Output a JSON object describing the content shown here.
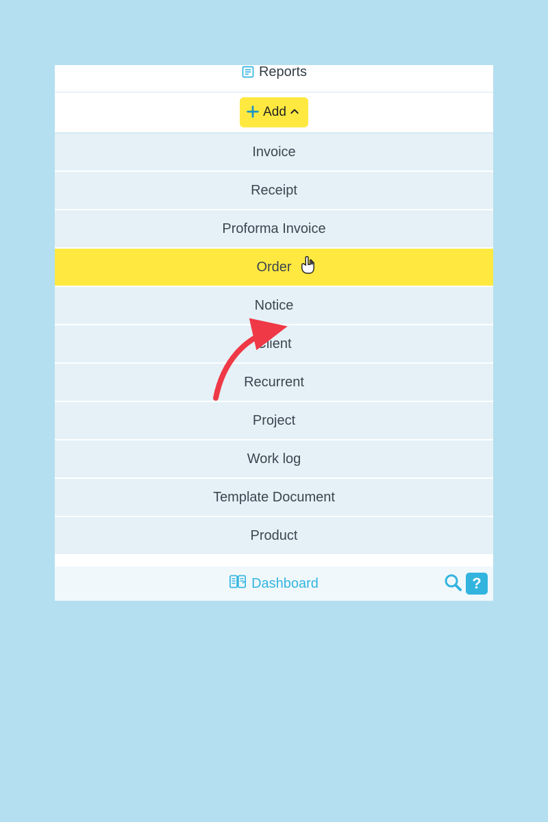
{
  "top": {
    "reports_label": "Reports"
  },
  "add_button": {
    "label": "Add"
  },
  "menu": {
    "items": [
      {
        "label": "Invoice",
        "highlight": false
      },
      {
        "label": "Receipt",
        "highlight": false
      },
      {
        "label": "Proforma Invoice",
        "highlight": false
      },
      {
        "label": "Order",
        "highlight": true
      },
      {
        "label": "Notice",
        "highlight": false
      },
      {
        "label": "Client",
        "highlight": false
      },
      {
        "label": "Recurrent",
        "highlight": false
      },
      {
        "label": "Project",
        "highlight": false
      },
      {
        "label": "Work log",
        "highlight": false
      },
      {
        "label": "Template Document",
        "highlight": false
      },
      {
        "label": "Product",
        "highlight": false
      }
    ]
  },
  "bottom": {
    "dashboard_label": "Dashboard",
    "help_label": "?"
  },
  "colors": {
    "accent_teal": "#32b4df",
    "highlight_yellow": "#ffe940",
    "arrow_red": "#ef3946"
  }
}
